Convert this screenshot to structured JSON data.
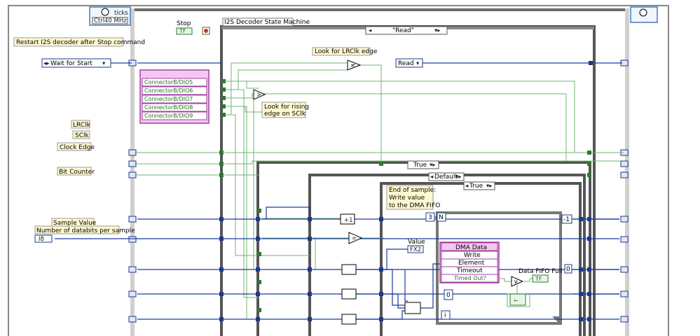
{
  "loop": {
    "timer_label": "ticks",
    "clock_value": "40 MHz",
    "clock_prefix": "Ctrl",
    "iteration_symbol": "i"
  },
  "stop": {
    "label": "Stop",
    "type": "TF"
  },
  "state_machine": {
    "label": "I2S Decoder State Machine",
    "case_selector": "\"Read\"",
    "read_enum": "Read"
  },
  "left_labels": {
    "restart_note": "Restart I2S decoder after Stop command",
    "wait_for_start": "Wait for Start",
    "lrclk": "LRClk",
    "sclk": "SClk",
    "clock_edge": "Clock Edge",
    "bit_counter": "Bit Counter",
    "sample_value": "Sample Value",
    "num_databits": "Number of databits per sample",
    "i8": "I8"
  },
  "io_node": {
    "items": [
      "ConnectorB/DIO5",
      "ConnectorB/DIO6",
      "ConnectorB/DIO7",
      "ConnectorB/DIO8",
      "ConnectorB/DIO9"
    ]
  },
  "comments": {
    "lrclk_edge": "Look for LRClk edge",
    "rising_edge": [
      "Look for rising",
      "edge on SClk"
    ],
    "end_sample": [
      "End of sample:",
      "Write value",
      "to the DMA FIFO"
    ]
  },
  "cases": {
    "true1": "True",
    "default": "Default",
    "true2": "True"
  },
  "fifo": {
    "value_label": "Value",
    "fx": "FX2",
    "n_const": "3",
    "n_label": "N",
    "minus_one": "-1",
    "zero_right": "0",
    "zero_inner": "0",
    "title": "DMA Data",
    "rows": [
      "Write",
      "Element",
      "Timeout",
      "Timed Out?"
    ],
    "full_label": "Data FIFO Full",
    "full_type": "TF",
    "inner_i": "i"
  }
}
